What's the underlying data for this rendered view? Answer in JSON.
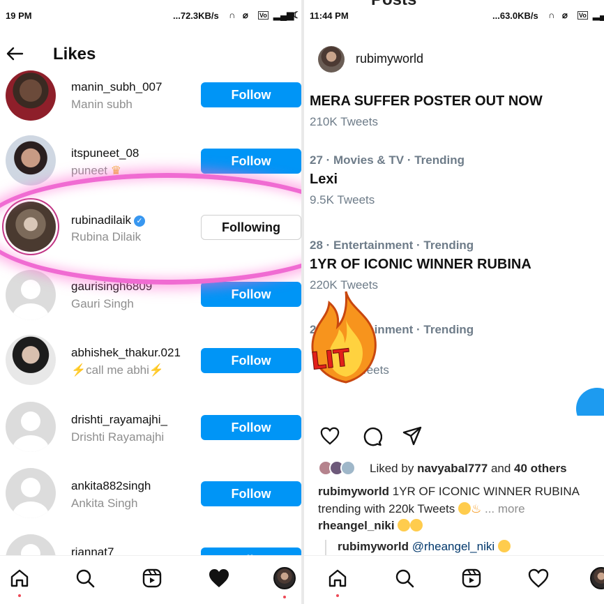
{
  "left": {
    "status": {
      "time": "19 PM",
      "speed": "...72.3KB/s"
    },
    "header": {
      "back_icon": "arrow-left-icon",
      "title": "Likes"
    },
    "likes": [
      {
        "username": "manin_subh_007",
        "fullname": "Manin subh",
        "button": "Follow"
      },
      {
        "username": "itspuneet_08",
        "fullname": "puneet",
        "button": "Follow"
      },
      {
        "username": "rubinadilaik",
        "fullname": "Rubina Dilaik",
        "button": "Following",
        "verified": true
      },
      {
        "username": "gaurisingh6809",
        "fullname": "Gauri Singh",
        "button": "Follow"
      },
      {
        "username": "abhishek_thakur.021",
        "fullname": "⚡call me abhi⚡",
        "button": "Follow"
      },
      {
        "username": "drishti_rayamajhi_",
        "fullname": "Drishti Rayamajhi",
        "button": "Follow"
      },
      {
        "username": "ankita882singh",
        "fullname": "Ankita Singh",
        "button": "Follow"
      },
      {
        "username": "riannat7",
        "fullname": "",
        "button": "Follow"
      }
    ],
    "nav": [
      "home-icon",
      "search-icon",
      "reels-icon",
      "heart-filled-icon",
      "profile-avatar"
    ]
  },
  "right": {
    "status": {
      "time": "11:44 PM",
      "speed": "...63.0KB/s"
    },
    "peek_title": "Posts",
    "post": {
      "username": "rubimyworld",
      "trends": [
        {
          "meta": "",
          "name": "MERA SUFFER POSTER OUT NOW",
          "count": "210K Tweets"
        },
        {
          "meta": "27 · Movies & TV · Trending",
          "name": "Lexi",
          "count": "9.5K Tweets"
        },
        {
          "meta": "28 · Entertainment · Trending",
          "name": "1YR OF ICONIC WINNER RUBINA",
          "count": "220K Tweets"
        },
        {
          "meta": "29 · Entertainment · Trending",
          "name": "",
          "count": "Tweets"
        }
      ],
      "sticker_text": "LIT",
      "liked_by_prefix": "Liked by",
      "liked_by_user": "navyabal777",
      "liked_by_and": "and",
      "liked_by_others": "40 others",
      "caption_user": "rubimyworld",
      "caption_text": "1YR OF ICONIC WINNER RUBINA trending with 220k Tweets",
      "caption_more": "... more",
      "comment_user": "rheangel_niki",
      "reply_user": "rubimyworld",
      "reply_mention": "@rheangel_niki"
    },
    "nav": [
      "home-icon",
      "search-icon",
      "reels-icon",
      "heart-outline-icon",
      "profile-avatar"
    ]
  },
  "colors": {
    "follow_blue": "#0095f6",
    "highlight_pink": "#f06bd2",
    "trend_grey": "#6e7c89",
    "notification_red": "#ed4956"
  }
}
